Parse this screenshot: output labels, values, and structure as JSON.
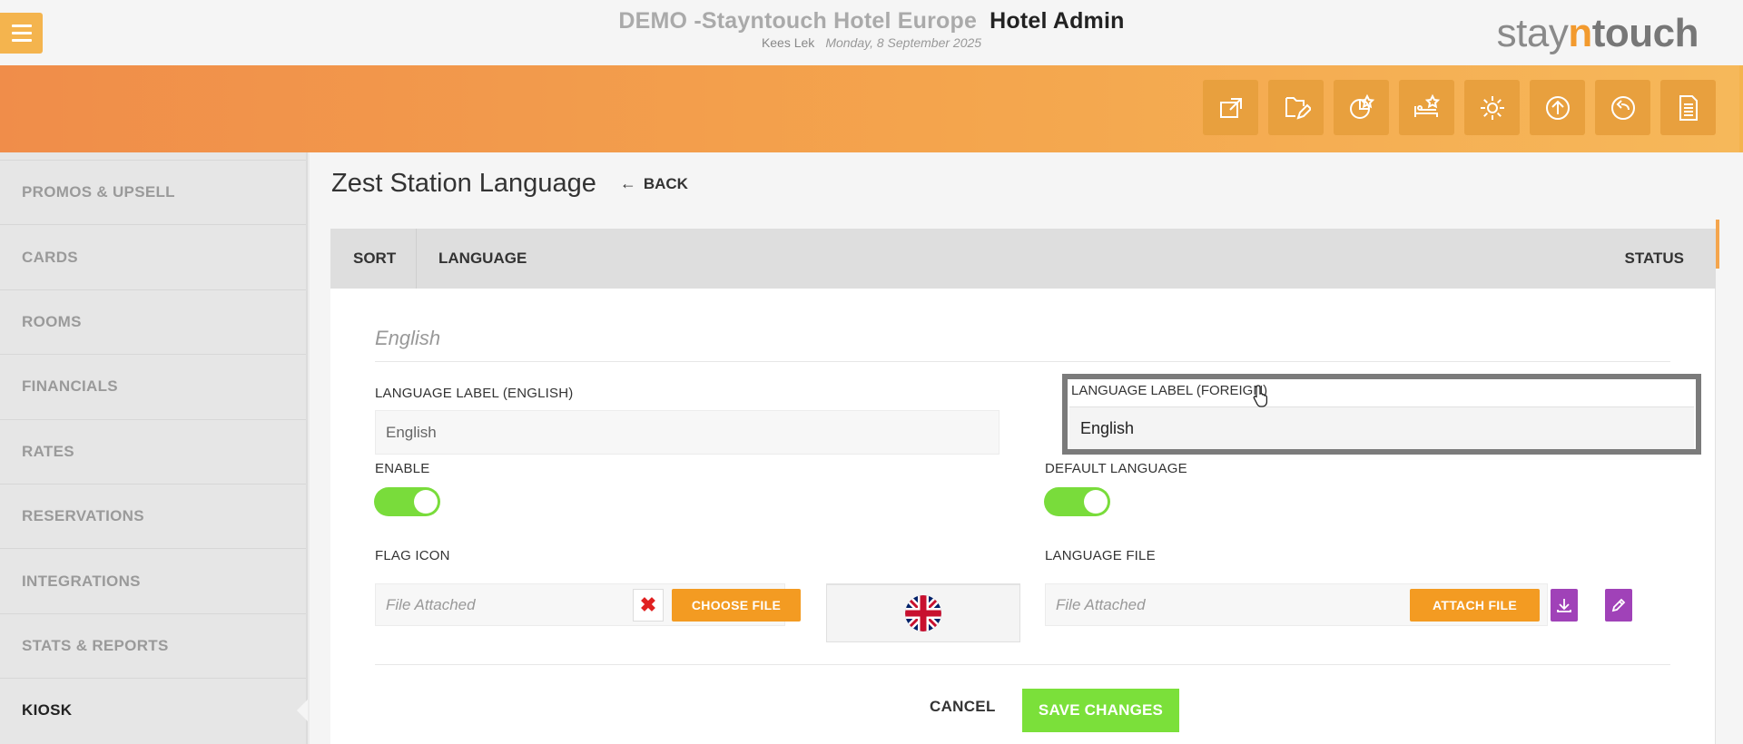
{
  "header": {
    "hotel_name": "DEMO -Stayntouch Hotel Europe",
    "app_name": "Hotel Admin",
    "user": "Kees Lek",
    "date": "Monday, 8 September 2025",
    "logo": {
      "stay": "stay",
      "n": "n",
      "touch": "touch"
    }
  },
  "toolbar": {
    "icons": [
      "external-link-icon",
      "edit-documents-icon",
      "chart-star-icon",
      "bed-star-icon",
      "gear-icon",
      "upload-icon",
      "logout-icon",
      "document-icon"
    ]
  },
  "sidebar": {
    "items": [
      {
        "label": "PROMOS & UPSELL"
      },
      {
        "label": "CARDS"
      },
      {
        "label": "ROOMS"
      },
      {
        "label": "FINANCIALS"
      },
      {
        "label": "RATES"
      },
      {
        "label": "RESERVATIONS"
      },
      {
        "label": "INTEGRATIONS"
      },
      {
        "label": "STATS & REPORTS"
      },
      {
        "label": "KIOSK"
      }
    ],
    "active": "KIOSK"
  },
  "page": {
    "title": "Zest Station Language",
    "back_label": "BACK"
  },
  "table": {
    "headers": {
      "sort": "SORT",
      "language": "LANGUAGE",
      "status": "STATUS"
    }
  },
  "form": {
    "language_name": "English",
    "label_english": {
      "label": "LANGUAGE LABEL (ENGLISH)",
      "value": "English"
    },
    "label_foreign": {
      "label": "LANGUAGE LABEL (FOREIGN)",
      "value": "English"
    },
    "enable": {
      "label": "ENABLE",
      "on": true
    },
    "default_language": {
      "label": "DEFAULT LANGUAGE",
      "on": true
    },
    "flag_icon": {
      "label": "FLAG ICON",
      "file_text": "File Attached",
      "choose_label": "CHOOSE FILE"
    },
    "language_file": {
      "label": "LANGUAGE FILE",
      "file_text": "File Attached",
      "attach_label": "ATTACH FILE"
    },
    "cancel_label": "CANCEL",
    "save_label": "SAVE CHANGES"
  },
  "colors": {
    "accent_orange": "#f39b22",
    "toggle_green": "#79dc3b",
    "purple": "#a042b8"
  }
}
